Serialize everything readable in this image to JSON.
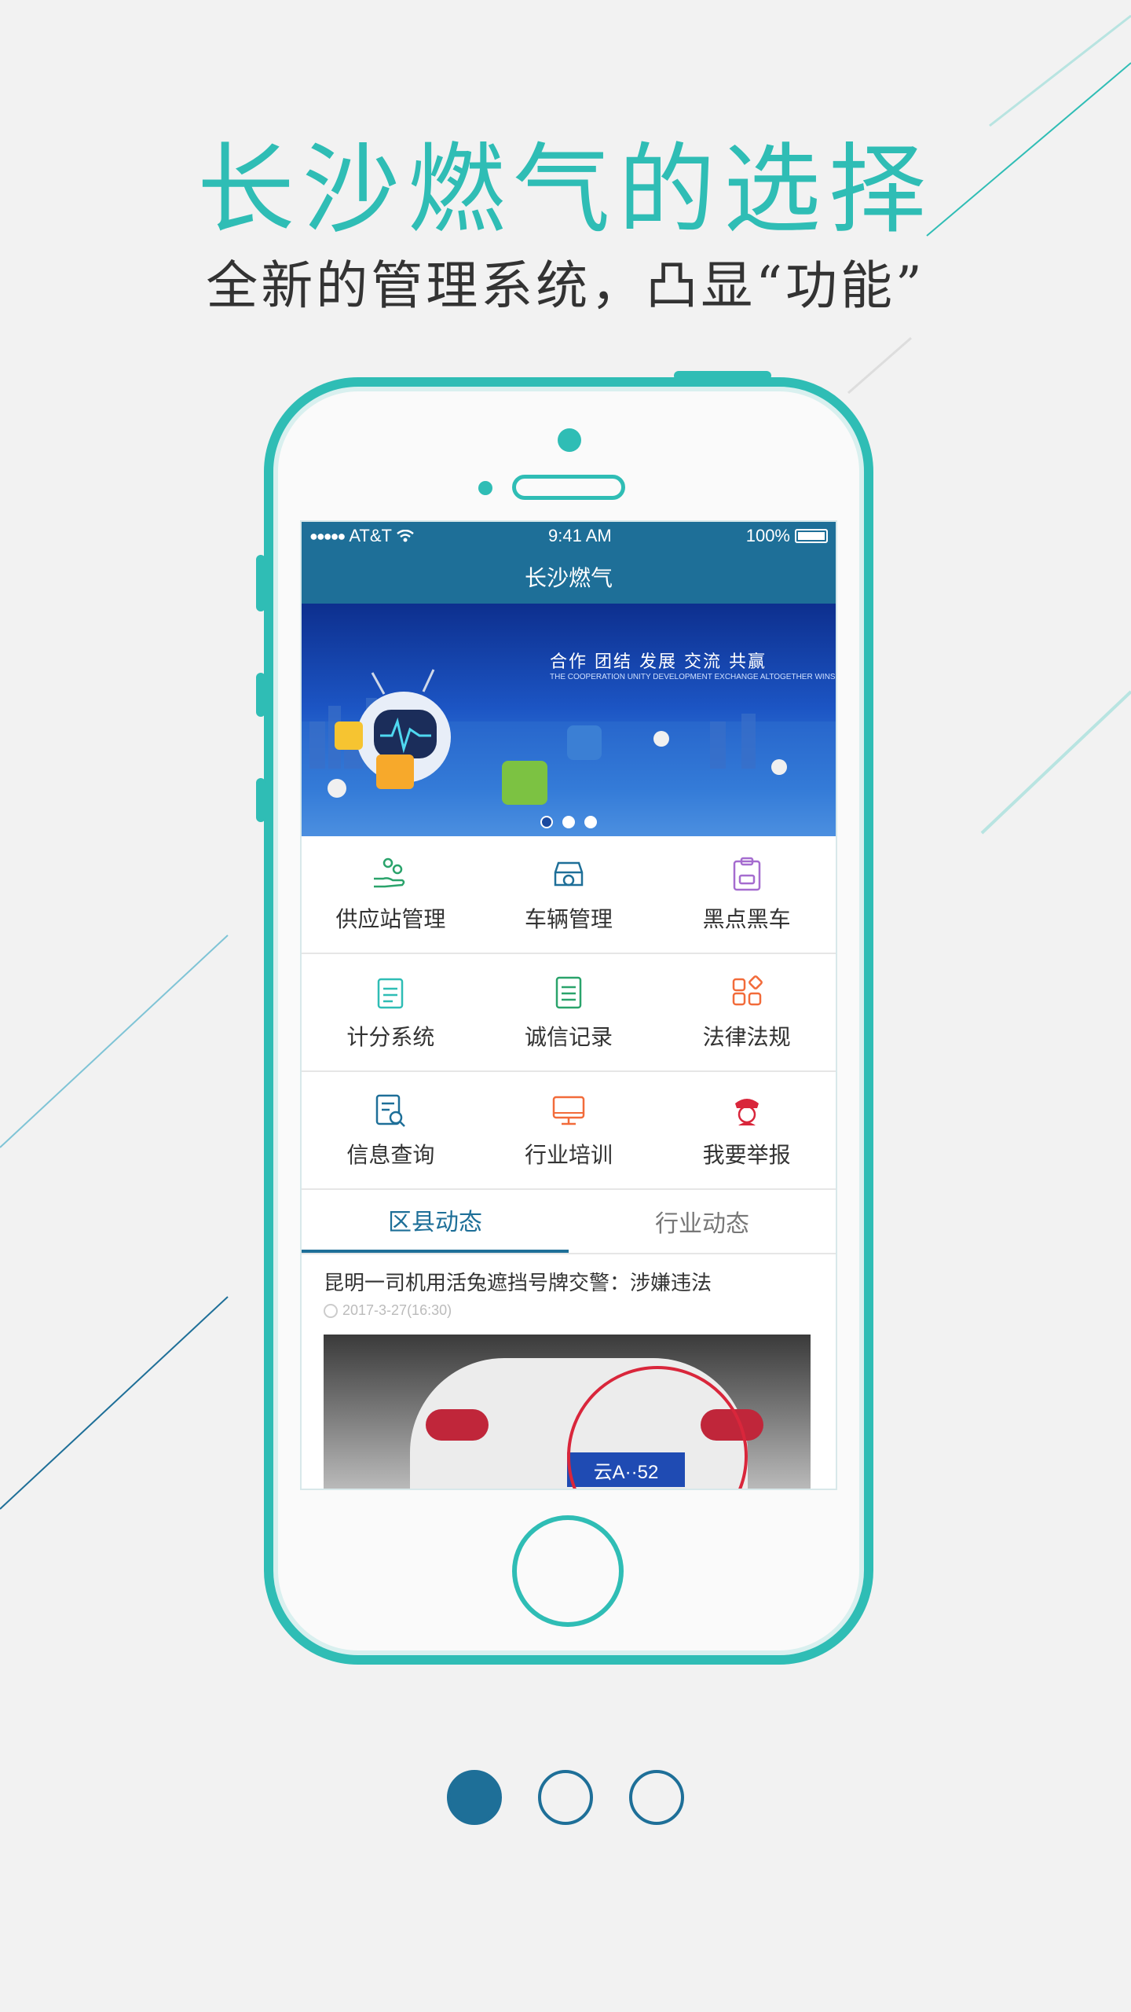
{
  "headline": "长沙燃气的选择",
  "subline": "全新的管理系统，凸显“功能”",
  "status": {
    "carrier": "AT&T",
    "time": "9:41 AM",
    "battery": "100%"
  },
  "nav": {
    "title": "长沙燃气"
  },
  "banner": {
    "title": "合作  团结  发展  交流  共赢",
    "subtitle": "THE COOPERATION UNITY DEVELOPMENT EXCHANGE ALTOGETHER WINS",
    "page_count": 3,
    "active_page": 1
  },
  "menu": [
    {
      "label": "供应站管理",
      "icon": "hand-coins-icon",
      "color": "#2aa36b"
    },
    {
      "label": "车辆管理",
      "icon": "car-icon",
      "color": "#1e6f98"
    },
    {
      "label": "黑点黑车",
      "icon": "clipboard-car-icon",
      "color": "#a56ccf"
    },
    {
      "label": "计分系统",
      "icon": "score-notepad-icon",
      "color": "#2fbdb5"
    },
    {
      "label": "诚信记录",
      "icon": "document-list-icon",
      "color": "#2aa36b"
    },
    {
      "label": "法律法规",
      "icon": "apps-grid-icon",
      "color": "#f26b3a"
    },
    {
      "label": "信息查询",
      "icon": "search-document-icon",
      "color": "#1e6f98"
    },
    {
      "label": "行业培训",
      "icon": "monitor-icon",
      "color": "#f26b3a"
    },
    {
      "label": "我要举报",
      "icon": "police-icon",
      "color": "#d9263b"
    }
  ],
  "tabs": [
    {
      "label": "区县动态",
      "active": true
    },
    {
      "label": "行业动态",
      "active": false
    }
  ],
  "news": {
    "title": "昆明一司机用活兔遮挡号牌交警：涉嫌违法",
    "time": "2017-3-27(16:30)",
    "plate": "云A··52"
  },
  "pager": {
    "page_count": 3,
    "active_page": 1
  },
  "colors": {
    "accent": "#2fbdb5",
    "primary": "#1e6f98"
  }
}
